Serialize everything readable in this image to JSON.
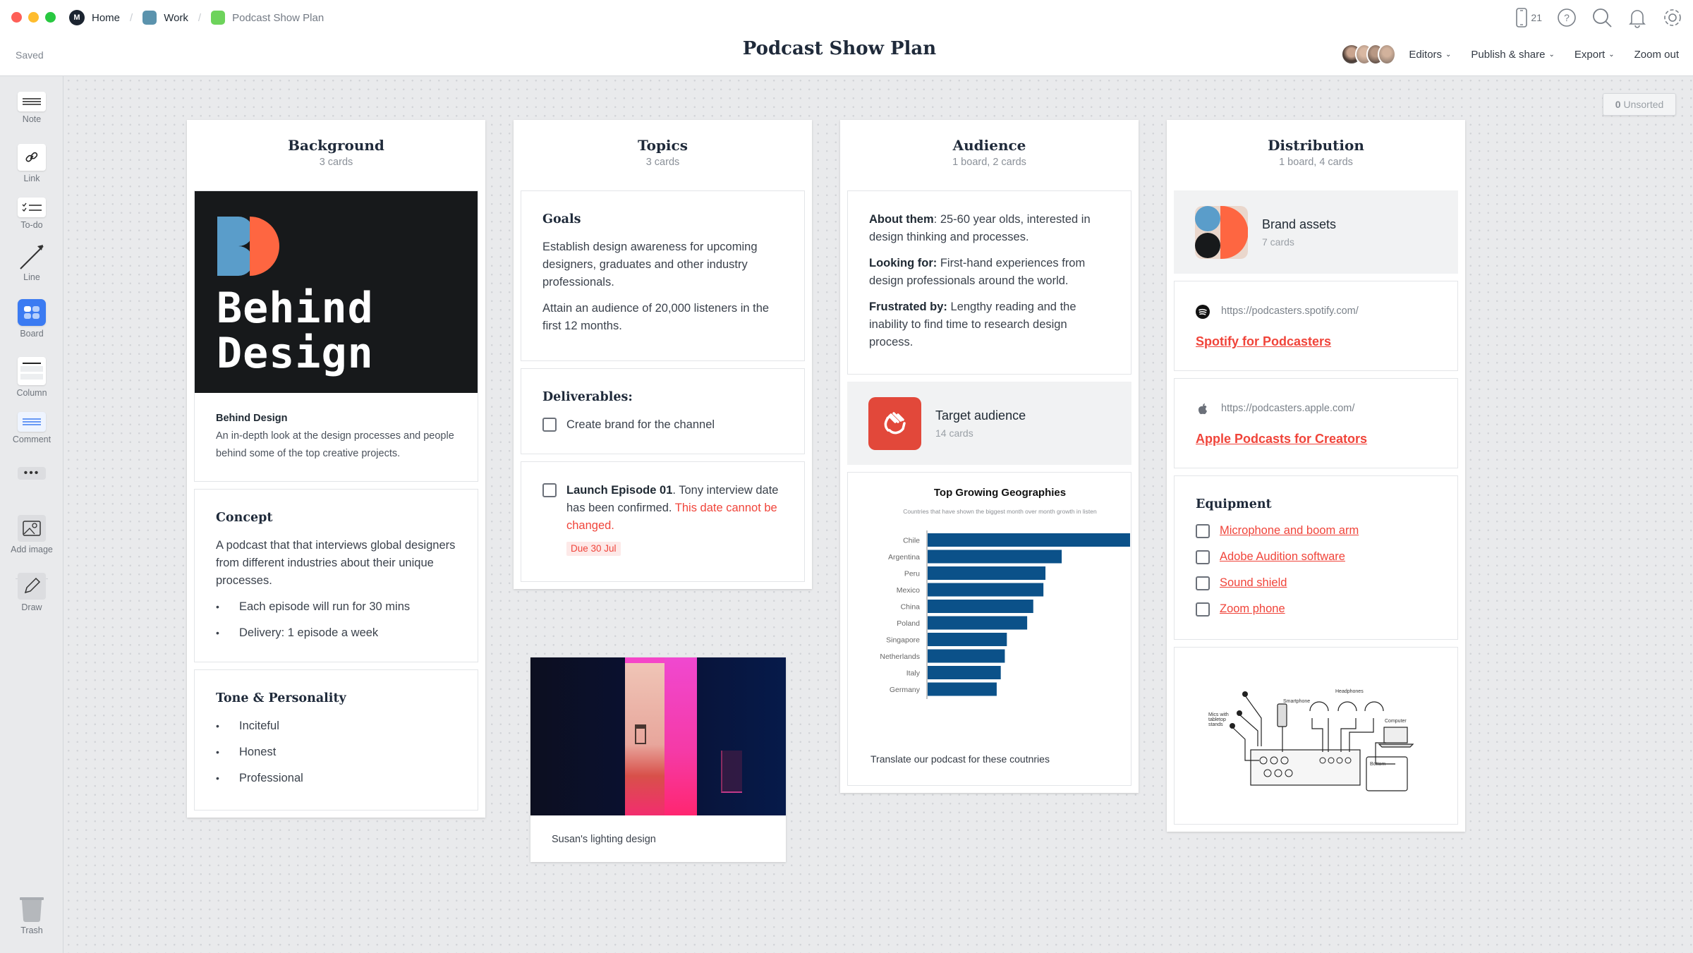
{
  "window": {
    "traffic_lights": [
      "#fe5f57",
      "#febc2e",
      "#28c840"
    ]
  },
  "breadcrumb": [
    {
      "label": "Home",
      "icon": "milanote-logo-icon"
    },
    {
      "label": "Work",
      "color": "#5b93ad"
    },
    {
      "label": "Podcast Show Plan",
      "color": "#6dd35b"
    }
  ],
  "header": {
    "status": "Saved",
    "title": "Podcast Show Plan",
    "device_count": "21",
    "icons": [
      "mobile-device-icon",
      "help-icon",
      "search-icon",
      "bell-icon",
      "gear-icon"
    ],
    "menu": {
      "editors": "Editors",
      "publish": "Publish & share",
      "export": "Export",
      "zoom": "Zoom out"
    }
  },
  "toolbar": {
    "tools": [
      {
        "label": "Note",
        "icon": "note-icon"
      },
      {
        "label": "Link",
        "icon": "link-icon"
      },
      {
        "label": "To-do",
        "icon": "todo-icon"
      },
      {
        "label": "Line",
        "icon": "line-arrow-icon"
      },
      {
        "label": "Board",
        "icon": "board-icon"
      },
      {
        "label": "Column",
        "icon": "column-icon"
      },
      {
        "label": "Comment",
        "icon": "comment-icon"
      },
      {
        "label": "",
        "icon": "more-icon"
      },
      {
        "label": "Add image",
        "icon": "image-icon"
      },
      {
        "label": "Draw",
        "icon": "pencil-icon"
      }
    ],
    "trash": "Trash"
  },
  "unsorted": {
    "count": "0",
    "label": "Unsorted"
  },
  "columns": {
    "background": {
      "title": "Background",
      "subtitle": "3 cards",
      "image_card": {
        "art_text_line1": "Behind",
        "art_text_line2": "Design",
        "title": "Behind Design",
        "description": "An in-depth look at the design processes and people behind some of the top creative projects."
      },
      "concept": {
        "title": "Concept",
        "text": "A podcast that that interviews global designers from different industries about their unique processes.",
        "bullets": [
          "Each episode will run for 30 mins",
          "Delivery: 1 episode a week"
        ]
      },
      "tone": {
        "title": "Tone & Personality",
        "bullets": [
          "Inciteful",
          "Honest",
          "Professional"
        ]
      }
    },
    "topics": {
      "title": "Topics",
      "subtitle": "3 cards",
      "goals": {
        "title": "Goals",
        "p1": "Establish design awareness for upcoming designers, graduates and other industry professionals.",
        "p2": "Attain an audience of 20,000 listeners in the first 12 months."
      },
      "deliverables": {
        "title": "Deliverables:",
        "item": "Create brand for the channel",
        "checked": false
      },
      "launch": {
        "bold": "Launch Episode 01",
        "text": ". Tony interview date has been confirmed. ",
        "warning": "This date cannot be changed.",
        "due": "Due 30 Jul",
        "checked": false
      }
    },
    "audience": {
      "title": "Audience",
      "subtitle": "1 board, 2 cards",
      "about": {
        "label": "About them",
        "text": ": 25-60 year olds, interested in design thinking and processes."
      },
      "looking": {
        "label": "Looking for:",
        "text": " First-hand experiences from design professionals around the world."
      },
      "frustrated": {
        "label": "Frustrated by:",
        "text": " Lengthy reading and the inability to find time to research design process."
      },
      "board": {
        "title": "Target audience",
        "subtitle": "14 cards",
        "color": "#e2483a"
      },
      "chart_caption": "Translate our podcast for these coutnries"
    },
    "distribution": {
      "title": "Distribution",
      "subtitle": "1 board, 4 cards",
      "board": {
        "title": "Brand assets",
        "subtitle": "7 cards"
      },
      "links": [
        {
          "url": "https://podcasters.spotify.com/",
          "title": "Spotify for Podcasters",
          "icon": "spotify-icon"
        },
        {
          "url": "https://podcasters.apple.com/",
          "title": "Apple Podcasts for Creators",
          "icon": "apple-icon"
        }
      ],
      "equipment": {
        "title": "Equipment",
        "items": [
          "Microphone and boom arm",
          "Adobe Audition software",
          "Sound shield",
          "Zoom phone"
        ]
      },
      "diagram_labels": {
        "mics": "Mics with tabletop stands",
        "smartphone": "Smartphone",
        "headphones": "Headphones",
        "computer": "Computer",
        "bottom": "Bottom"
      }
    }
  },
  "photo_card": {
    "caption": "Susan's lighting design"
  },
  "chart_data": {
    "type": "bar",
    "orientation": "horizontal",
    "title": "Top Growing Geographies",
    "subtitle": "Countries that have shown the biggest month over month growth in listen",
    "categories": [
      "Chile",
      "Argentina",
      "Peru",
      "Mexico",
      "China",
      "Poland",
      "Singapore",
      "Netherlands",
      "Italy",
      "Germany"
    ],
    "values": [
      100,
      66,
      58,
      57,
      52,
      49,
      39,
      38,
      36,
      34
    ],
    "value_units": "relative (Chile = 100, no axis shown)",
    "xlabel": "",
    "ylabel": "",
    "xlim": [
      0,
      100
    ],
    "grid": false,
    "legend": "none",
    "bar_color": "#0b5189"
  }
}
